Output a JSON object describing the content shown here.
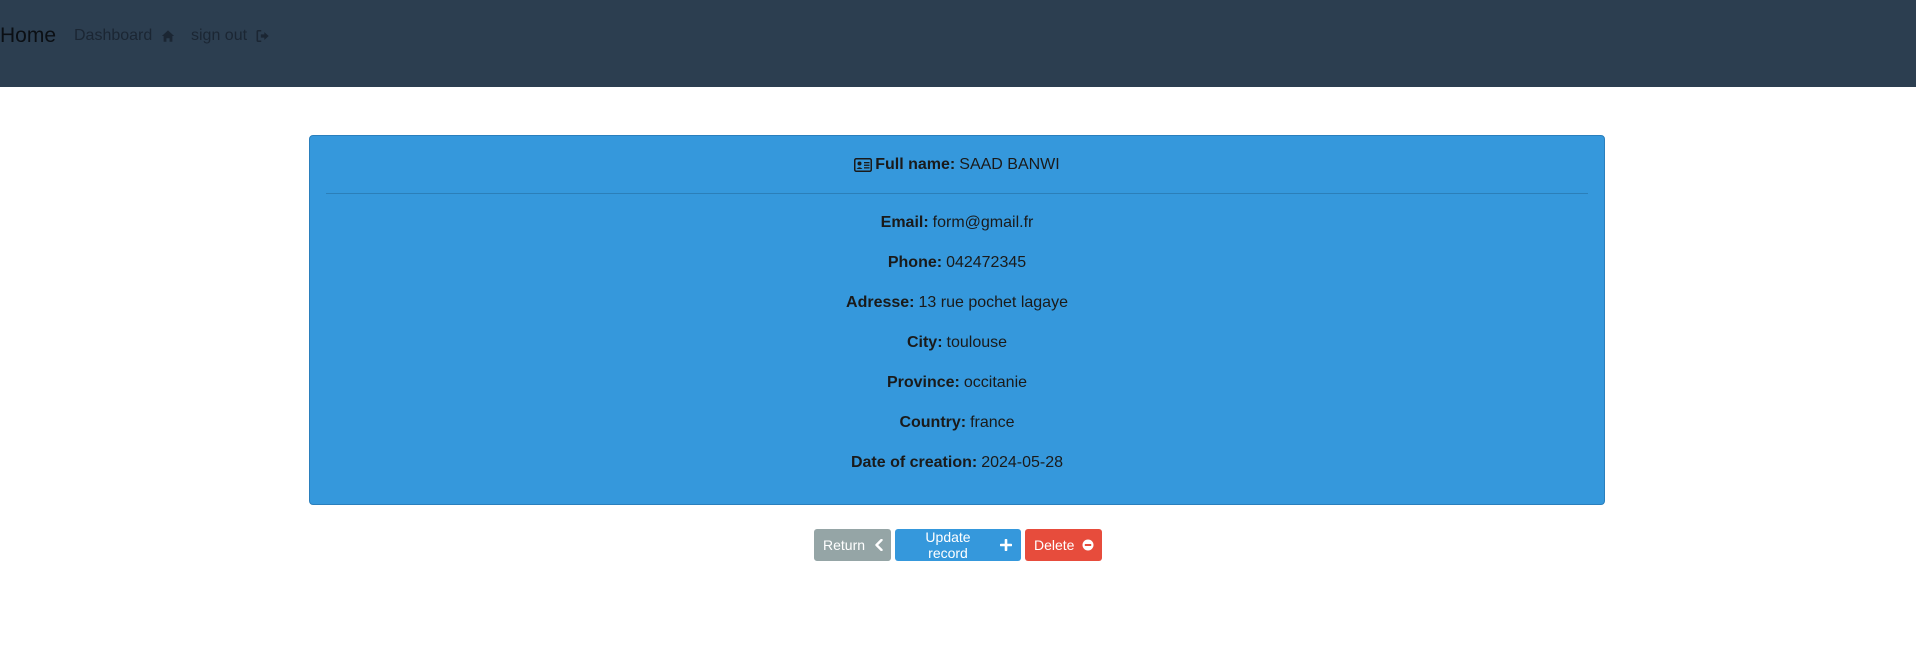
{
  "nav": {
    "brand": "Home",
    "dashboard_label": "Dashboard",
    "dashboard_icon": "home-icon",
    "signout_label": "sign out",
    "signout_icon": "sign-out-icon"
  },
  "record": {
    "header_icon": "id-card-icon",
    "fullname_label": "Full name:",
    "fullname_value": "SAAD BANWI",
    "fields": [
      {
        "label": "Email:",
        "value": "form@gmail.fr"
      },
      {
        "label": "Phone:",
        "value": "042472345"
      },
      {
        "label": "Adresse:",
        "value": "13 rue pochet lagaye"
      },
      {
        "label": "City:",
        "value": "toulouse"
      },
      {
        "label": "Province:",
        "value": "occitanie"
      },
      {
        "label": "Country:",
        "value": "france"
      },
      {
        "label": "Date of creation:",
        "value": "2024-05-28"
      }
    ]
  },
  "actions": {
    "return_label": "Return",
    "return_icon": "chevron-left-icon",
    "update_label": "Update record",
    "update_icon": "plus-icon",
    "delete_label": "Delete",
    "delete_icon": "minus-circle-icon"
  },
  "colors": {
    "navbar": "#2c3e50",
    "card": "#3598dc",
    "return_button": "#95a5a6",
    "update_button": "#3598dc",
    "delete_button": "#e74c3c"
  }
}
